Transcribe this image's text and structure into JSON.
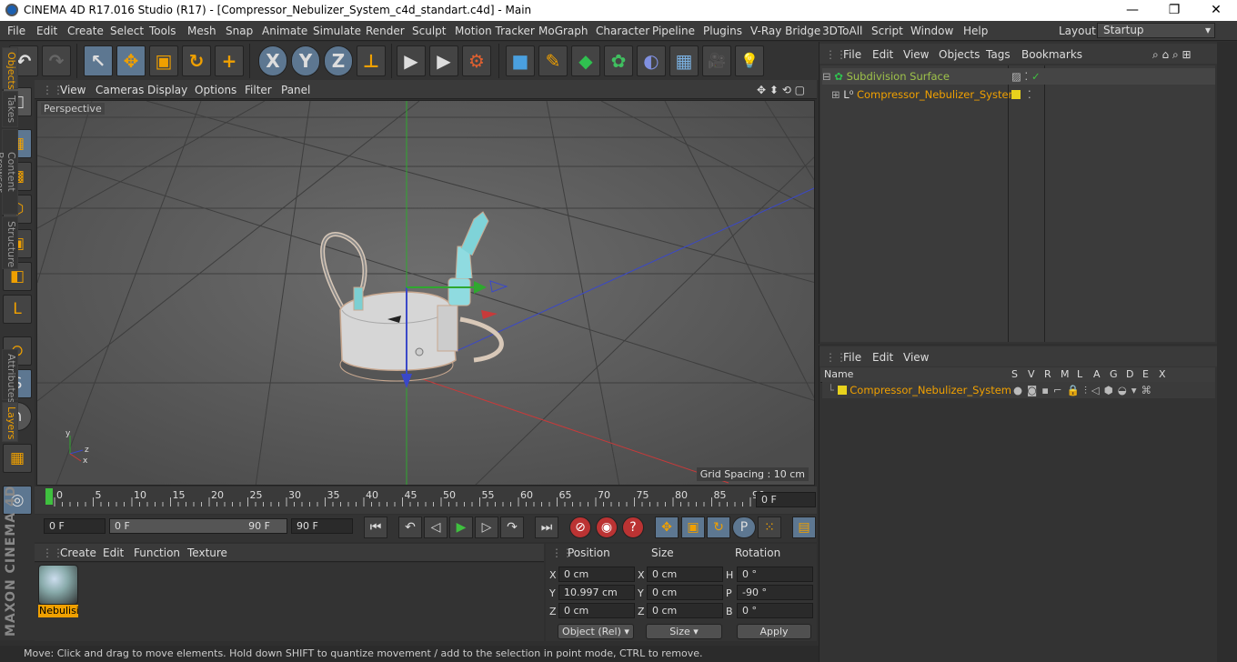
{
  "window": {
    "title": "CINEMA 4D R17.016 Studio (R17) - [Compressor_Nebulizer_System_c4d_standart.c4d] - Main",
    "minimize": "—",
    "maximize": "❐",
    "close": "✕"
  },
  "menu": [
    "File",
    "Edit",
    "Create",
    "Select",
    "Tools",
    "Mesh",
    "Snap",
    "Animate",
    "Simulate",
    "Render",
    "Sculpt",
    "Motion Tracker",
    "MoGraph",
    "Character",
    "Pipeline",
    "Plugins",
    "V-Ray Bridge",
    "3DToAll",
    "Script",
    "Window",
    "Help"
  ],
  "layout": {
    "label": "Layout:",
    "value": "Startup"
  },
  "toolbar": {
    "undo": "↶",
    "redo": "↷",
    "live_select": "↖",
    "move": "✥",
    "scale": "▣",
    "rotate": "↻",
    "add": "+",
    "x_axis": "X",
    "y_axis": "Y",
    "z_axis": "Z",
    "world": "⊥",
    "render_view": "▶",
    "render_pic": "▶",
    "render_settings": "⚙",
    "cube": "■",
    "pen": "✎",
    "subdiv": "◆",
    "cloner": "✿",
    "deformer": "◐",
    "floor": "▦",
    "camera": "🎥",
    "light": "💡"
  },
  "left_tools": [
    "◫",
    "▦",
    "▩",
    "⬡",
    "▣",
    "◧",
    "L",
    "⊙",
    "S",
    "∩",
    "▦",
    "◎"
  ],
  "viewport": {
    "menu": [
      "View",
      "Cameras",
      "Display",
      "Options",
      "Filter",
      "Panel"
    ],
    "label": "Perspective",
    "grid_spacing": "Grid Spacing : 10 cm"
  },
  "timeline": {
    "ticks": [
      "0",
      "5",
      "10",
      "15",
      "20",
      "25",
      "30",
      "35",
      "40",
      "45",
      "50",
      "55",
      "60",
      "65",
      "70",
      "75",
      "80",
      "85",
      "90"
    ],
    "current_frame": "0 F"
  },
  "transport": {
    "start": "0 F",
    "range_start": "0 F",
    "range_end": "90 F",
    "end": "90 F"
  },
  "materials": {
    "menu": [
      "Create",
      "Edit",
      "Function",
      "Texture"
    ],
    "items": [
      {
        "name": "Nebulisi"
      }
    ]
  },
  "coordinates": {
    "headers": [
      "Position",
      "Size",
      "Rotation"
    ],
    "position": {
      "x": "0 cm",
      "y": "10.997 cm",
      "z": "0 cm"
    },
    "size": {
      "x": "0 cm",
      "y": "0 cm",
      "z": "0 cm"
    },
    "rotation": {
      "h": "0 °",
      "p": "-90 °",
      "b": "0 °"
    },
    "axis_labels": {
      "x": "X",
      "y": "Y",
      "z": "Z",
      "h": "H",
      "p": "P",
      "b": "B"
    },
    "mode": "Object (Rel)",
    "size_mode": "Size",
    "apply": "Apply"
  },
  "objects": {
    "menu": [
      "File",
      "Edit",
      "View",
      "Objects",
      "Tags",
      "Bookmarks"
    ],
    "items": [
      {
        "name": "Subdivision Surface",
        "color": "#9ec24a"
      },
      {
        "name": "Compressor_Nebulizer_System",
        "color": "#f0a000"
      }
    ]
  },
  "layers": {
    "menu": [
      "File",
      "Edit",
      "View"
    ],
    "columns": [
      "Name",
      "S",
      "V",
      "R",
      "M",
      "L",
      "A",
      "G",
      "D",
      "E",
      "X"
    ],
    "items": [
      {
        "name": "Compressor_Nebulizer_System",
        "color": "#e8d21d"
      }
    ]
  },
  "side_tabs": [
    "Objects",
    "Takes",
    "Content Browser",
    "Structure",
    "Attributes",
    "Layers"
  ],
  "status": "Move: Click and drag to move elements. Hold down SHIFT to quantize movement / add to the selection in point mode, CTRL to remove.",
  "colors": {
    "accent": "#f0a000",
    "selected_tool": "#5d7791",
    "panel": "#333333"
  }
}
